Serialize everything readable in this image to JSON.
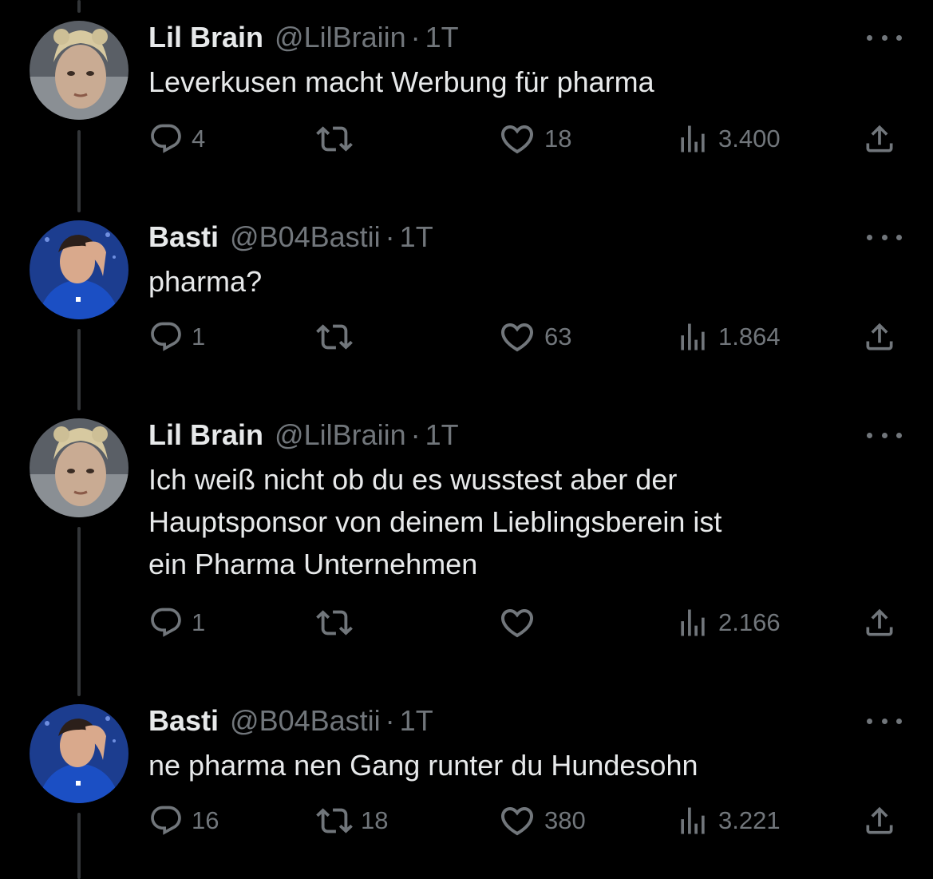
{
  "tweets": [
    {
      "name": "Lil Brain",
      "handle": "@LilBraiin",
      "separator": "·",
      "time": "1T",
      "text": "Leverkusen macht Werbung für pharma",
      "replies": "4",
      "retweets": "",
      "likes": "18",
      "views": "3.400",
      "avatar": "lil-brain-avatar"
    },
    {
      "name": "Basti",
      "handle": "@B04Bastii",
      "separator": "·",
      "time": "1T",
      "text": "pharma?",
      "replies": "1",
      "retweets": "",
      "likes": "63",
      "views": "1.864",
      "avatar": "basti-avatar"
    },
    {
      "name": "Lil Brain",
      "handle": "@LilBraiin",
      "separator": "·",
      "time": "1T",
      "text": "Ich weiß nicht ob du es wusstest aber der\nHauptsponsor von deinem Lieblingsberein ist\nein Pharma Unternehmen",
      "replies": "1",
      "retweets": "",
      "likes": "",
      "views": "2.166",
      "avatar": "lil-brain-avatar"
    },
    {
      "name": "Basti",
      "handle": "@B04Bastii",
      "separator": "·",
      "time": "1T",
      "text": "ne pharma nen Gang runter du Hundesohn",
      "replies": "16",
      "retweets": "18",
      "likes": "380",
      "views": "3.221",
      "avatar": "basti-avatar"
    }
  ],
  "icons": {
    "reply": "reply-icon",
    "retweet": "retweet-icon",
    "like": "heart-icon",
    "views": "views-icon",
    "share": "share-icon",
    "more": "more-icon"
  },
  "colors": {
    "background": "#000000",
    "text": "#e7e9ea",
    "muted": "#71767b",
    "thread_line": "#333639"
  }
}
